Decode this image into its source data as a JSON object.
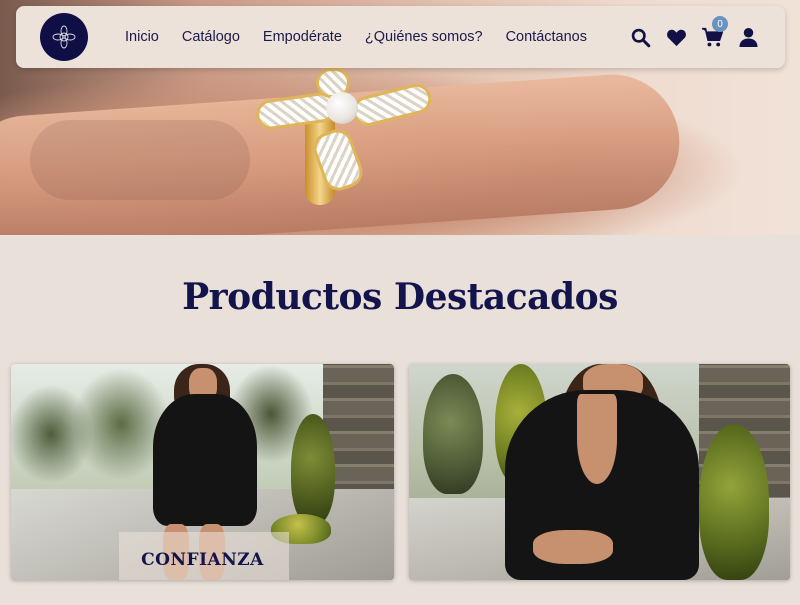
{
  "nav": {
    "links": [
      "Inicio",
      "Catálogo",
      "Empodérate",
      "¿Quiénes somos?",
      "Contáctanos"
    ],
    "cart_count": "0",
    "icons": [
      "search-icon",
      "heart-icon",
      "cart-icon",
      "user-icon"
    ]
  },
  "section": {
    "title": "Productos Destacados"
  },
  "products": [
    {
      "label": "CONFIANZA"
    },
    {
      "label": ""
    }
  ],
  "colors": {
    "brand_navy": "#14144d",
    "background": "#e8e0d9",
    "badge": "#6a93bf"
  }
}
